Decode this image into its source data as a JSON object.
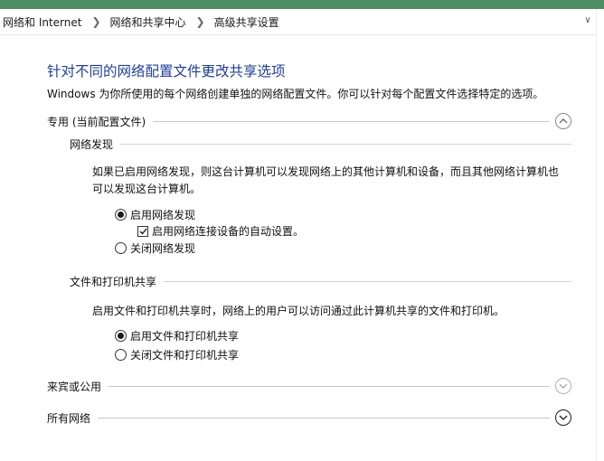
{
  "breadcrumb": {
    "items": [
      "网络和 Internet",
      "网络和共享中心",
      "高级共享设置"
    ],
    "separator_icon": "chevron-right-icon"
  },
  "page": {
    "title": "针对不同的网络配置文件更改共享选项",
    "description": "Windows 为你所使用的每个网络创建单独的网络配置文件。你可以针对每个配置文件选择特定的选项。"
  },
  "profiles": {
    "private": {
      "label": "专用 (当前配置文件)",
      "expanded": true,
      "network_discovery": {
        "heading": "网络发现",
        "description": "如果已启用网络发现，则这台计算机可以发现网络上的其他计算机和设备，而且其他网络计算机也可以发现这台计算机。",
        "on_label": "启用网络发现",
        "auto_setup_label": "启用网络连接设备的自动设置。",
        "off_label": "关闭网络发现",
        "selected": "on",
        "auto_setup_checked": true
      },
      "file_printer_sharing": {
        "heading": "文件和打印机共享",
        "description": "启用文件和打印机共享时，网络上的用户可以访问通过此计算机共享的文件和打印机。",
        "on_label": "启用文件和打印机共享",
        "off_label": "关闭文件和打印机共享",
        "selected": "on"
      }
    },
    "guest_public": {
      "label": "来宾或公用",
      "expanded": false
    },
    "all_networks": {
      "label": "所有网络",
      "expanded": false
    }
  },
  "colors": {
    "title": "#1e3f9a",
    "top_band": "#4e8f63"
  }
}
